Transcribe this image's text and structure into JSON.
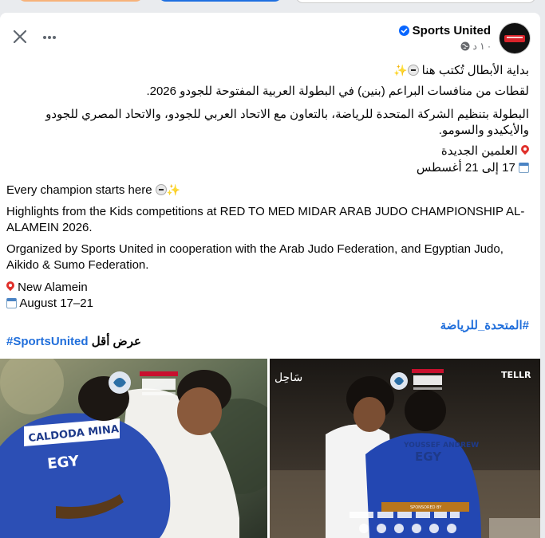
{
  "post": {
    "page_name": "Sports United",
    "time": "١ د ·",
    "arabic": {
      "line1": "بداية الأبطال تُكتب هنا",
      "line2": "لقطات من منافسات البراعم (بنين) في البطولة العربية المفتوحة للجودو 2026.",
      "line3a": "البطولة بتنظيم الشركة المتحدة للرياضة، بالتعاون مع الاتحاد العربي للجودو، والاتحاد المصري للجودو",
      "line3b": "والأيكيدو والسومو.",
      "location": "العلمين الجديدة",
      "dates": "17 إلى 21 أغسطس"
    },
    "english": {
      "line1": "Every champion starts here",
      "line2a": "Highlights from the Kids competitions at RED TO MED MIDAR ARAB JUDO CHAMPIONSHIP AL-",
      "line2b": "ALAMEIN 2026.",
      "line3a": "Organized by Sports United in cooperation with the Arab Judo Federation, and Egyptian Judo,",
      "line3b": "Aikido & Sumo Federation.",
      "location": "New Alamein",
      "dates": "August 17–21"
    },
    "hashtag_ar": "#المتحدة_للرياضة",
    "hashtag_en": "#SportsUnited",
    "see_less": "عرض أقل"
  },
  "photos": {
    "left": {
      "event_logo_a": "RED TO MED",
      "event_logo_b": "ميدار",
      "event_logo_c": "البطولة العربية للجودو",
      "event_logo_d": "العلمين ٢٠٢٦",
      "back_name": "CALDODA MINA",
      "country": "EGY"
    },
    "right": {
      "sponsor_left": "سَاحِل",
      "sponsor_right": "TELLR",
      "event_logo_a": "RED TO MED",
      "event_logo_b": "ميدار",
      "event_logo_c": "البطولة العربية للجودو",
      "event_logo_d": "العلمين ٢٠٢٦",
      "back_name": "YOUSSEF ANDREW",
      "country": "EGY",
      "sponsored_by": "SPONSORED BY"
    }
  },
  "colors": {
    "link": "#216fdb",
    "verified": "#0866ff",
    "text": "#050505",
    "meta": "#65676b"
  },
  "icons": {
    "close": "close-icon",
    "more": "more-icon",
    "verified": "verified-badge-icon",
    "globe": "globe-icon"
  }
}
